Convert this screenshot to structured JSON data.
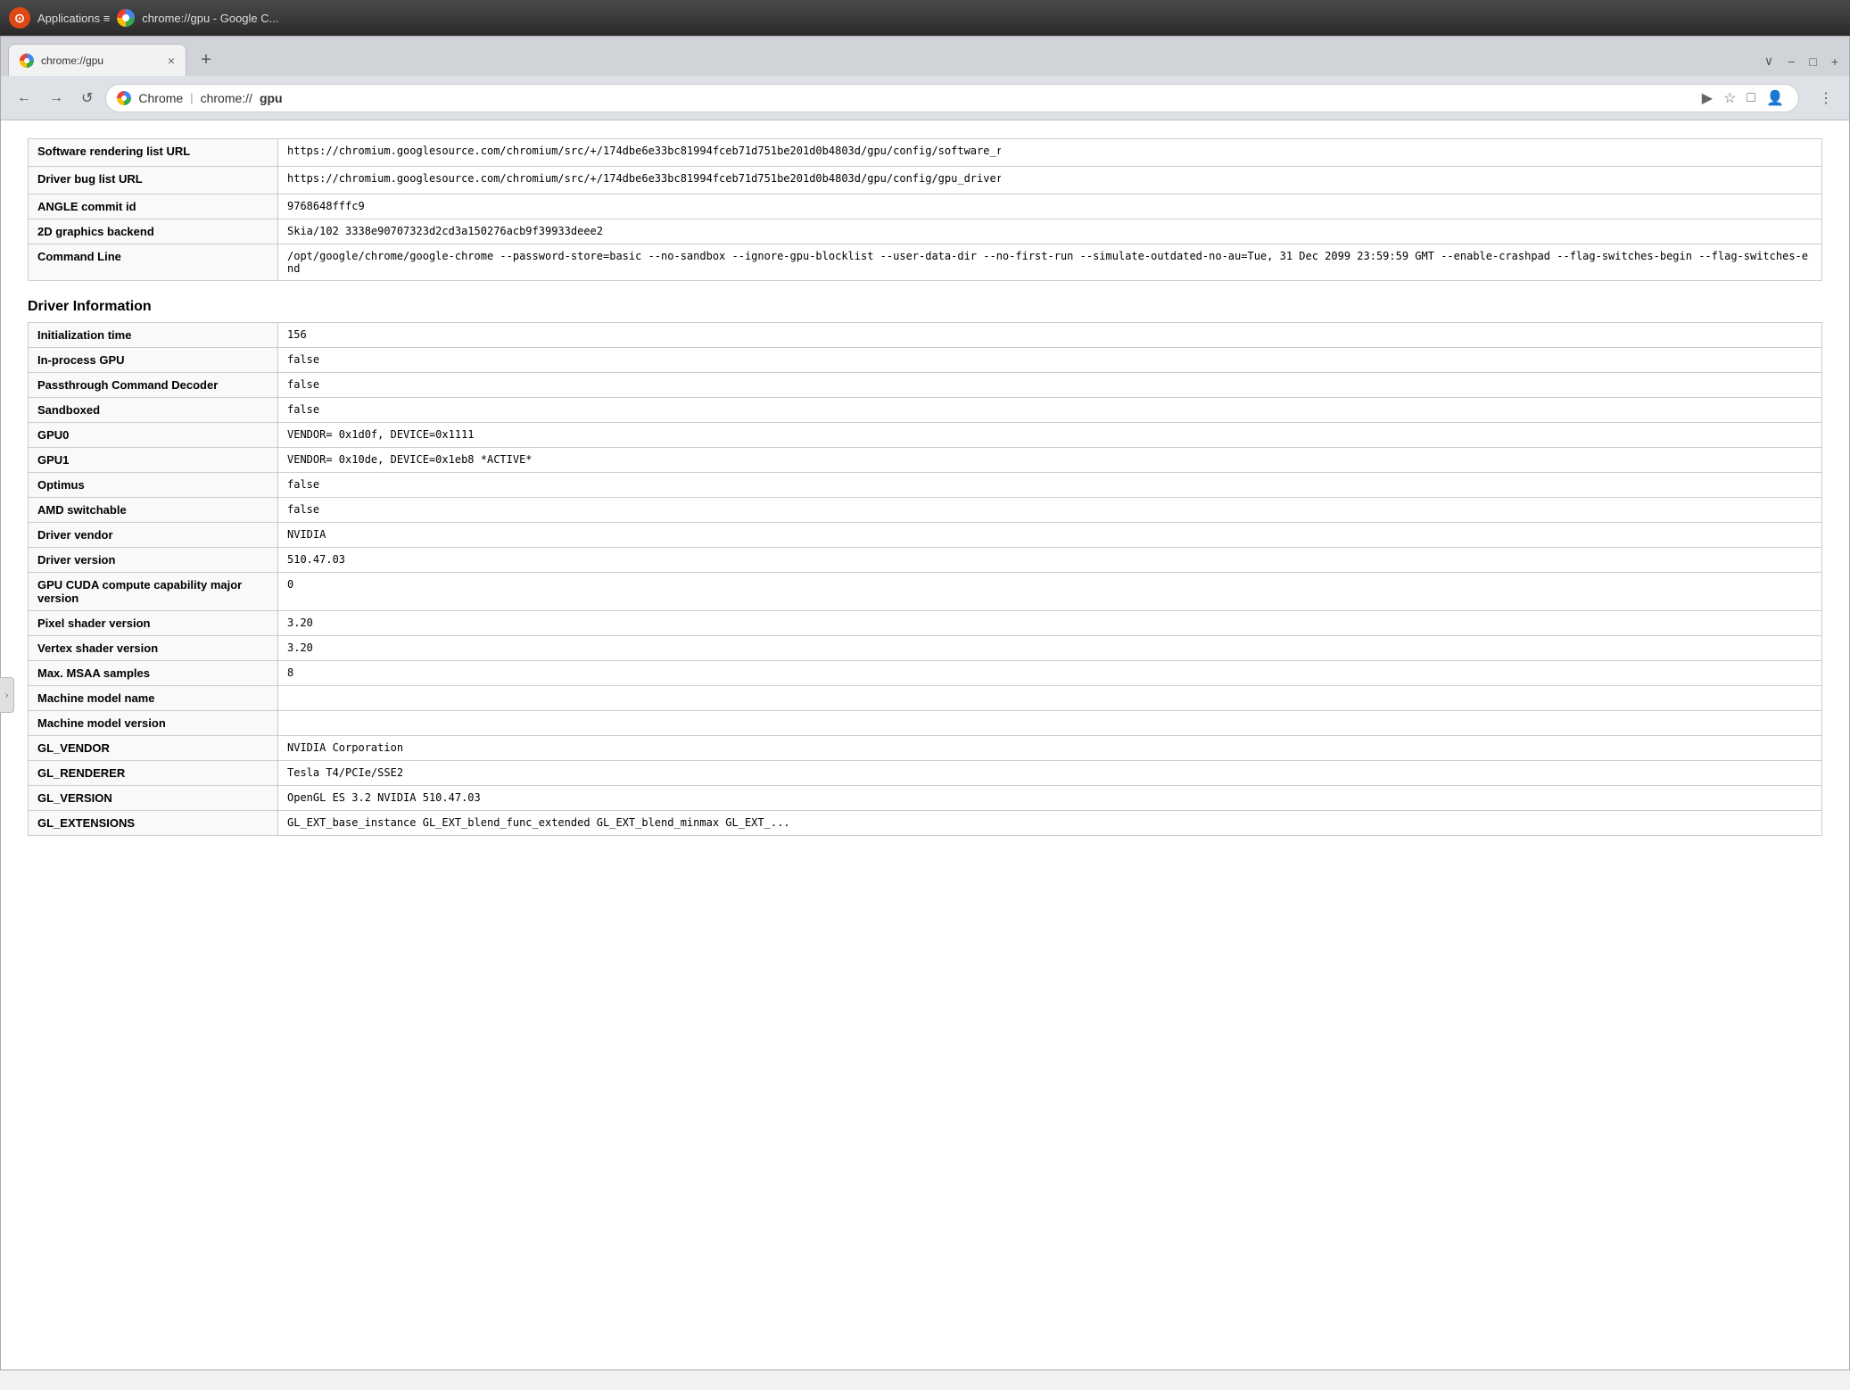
{
  "titleBar": {
    "ubuntuLabel": "⊙",
    "appsLabel": "Applications ≡",
    "windowTitle": "chrome://gpu - Google C...",
    "faviconAlt": "Chrome favicon"
  },
  "tabs": [
    {
      "label": "chrome://gpu",
      "url": "chrome://gpu",
      "active": true,
      "closeLabel": "×"
    }
  ],
  "tabActions": {
    "newTab": "+",
    "dropdownLabel": "∨",
    "minimizeLabel": "−",
    "maximizeLabel": "□",
    "closeLabel": "+"
  },
  "addressBar": {
    "backLabel": "←",
    "forwardLabel": "→",
    "reloadLabel": "↺",
    "siteLabel": "Chrome",
    "urlPrefix": "chrome://",
    "urlBold": "gpu",
    "bookmarkLabel": "☆",
    "tabsLabel": "□",
    "profileLabel": "👤",
    "menuLabel": "⋮",
    "navArrow": "▶"
  },
  "sections": [
    {
      "id": "version-info",
      "header": null,
      "rows": [
        {
          "label": "Software rendering list URL",
          "value": "https://chromium.googlesource.com/chromium/src/+/174dbe6e33bc81994fceb71d751be201d0b4803d/gpu/config/software_rendering_list.json"
        },
        {
          "label": "Driver bug list URL",
          "value": "https://chromium.googlesource.com/chromium/src/+/174dbe6e33bc81994fceb71d751be201d0b4803d/gpu/config/gpu_driver_bug_list.json"
        },
        {
          "label": "ANGLE commit id",
          "value": "9768648fffc9"
        },
        {
          "label": "2D graphics backend",
          "value": "Skia/102 3338e90707323d2cd3a150276acb9f39933deee2"
        },
        {
          "label": "Command Line",
          "value": "/opt/google/chrome/google-chrome --password-store=basic --no-sandbox --ignore-gpu-blocklist --user-data-dir --no-first-run --simulate-outdated-no-au=Tue, 31 Dec 2099 23:59:59 GMT --enable-crashpad --flag-switches-begin --flag-switches-end"
        }
      ]
    },
    {
      "id": "driver-info",
      "header": "Driver Information",
      "rows": [
        {
          "label": "Initialization time",
          "value": "156"
        },
        {
          "label": "In-process GPU",
          "value": "false"
        },
        {
          "label": "Passthrough Command Decoder",
          "value": "false"
        },
        {
          "label": "Sandboxed",
          "value": "false"
        },
        {
          "label": "GPU0",
          "value": "VENDOR= 0x1d0f, DEVICE=0x1111"
        },
        {
          "label": "GPU1",
          "value": "VENDOR= 0x10de, DEVICE=0x1eb8 *ACTIVE*"
        },
        {
          "label": "Optimus",
          "value": "false"
        },
        {
          "label": "AMD switchable",
          "value": "false"
        },
        {
          "label": "Driver vendor",
          "value": "NVIDIA"
        },
        {
          "label": "Driver version",
          "value": "510.47.03"
        },
        {
          "label": "GPU CUDA compute capability major version",
          "value": "0"
        },
        {
          "label": "Pixel shader version",
          "value": "3.20"
        },
        {
          "label": "Vertex shader version",
          "value": "3.20"
        },
        {
          "label": "Max. MSAA samples",
          "value": "8"
        },
        {
          "label": "Machine model name",
          "value": ""
        },
        {
          "label": "Machine model version",
          "value": ""
        },
        {
          "label": "GL_VENDOR",
          "value": "NVIDIA Corporation"
        },
        {
          "label": "GL_RENDERER",
          "value": "Tesla T4/PCIe/SSE2"
        },
        {
          "label": "GL_VERSION",
          "value": "OpenGL ES 3.2 NVIDIA 510.47.03"
        },
        {
          "label": "GL_EXTENSIONS",
          "value": "GL_EXT_base_instance GL_EXT_blend_func_extended GL_EXT_blend_minmax GL_EXT_..."
        }
      ]
    }
  ],
  "sidebarToggle": "›"
}
